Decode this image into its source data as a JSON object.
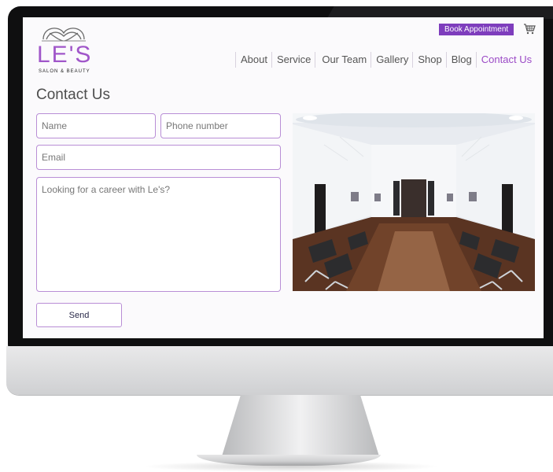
{
  "brand": {
    "name": "LE'S",
    "tagline": "SALON & BEAUTY",
    "accent_color": "#9b4ac6"
  },
  "header": {
    "book_button": "Book Appointment",
    "cart_icon": "shopping-cart-icon",
    "nav": [
      {
        "label": "About"
      },
      {
        "label": "Service"
      },
      {
        "label": "Our Team"
      },
      {
        "label": "Gallery"
      },
      {
        "label": "Shop"
      },
      {
        "label": "Blog"
      },
      {
        "label": "Contact Us",
        "active": true
      }
    ]
  },
  "main": {
    "title": "Contact Us",
    "form": {
      "name_placeholder": "Name",
      "phone_placeholder": "Phone number",
      "email_placeholder": "Email",
      "message_placeholder": "Looking for a career with Le's?",
      "send_label": "Send"
    },
    "photo": "salon-interior-photo"
  }
}
